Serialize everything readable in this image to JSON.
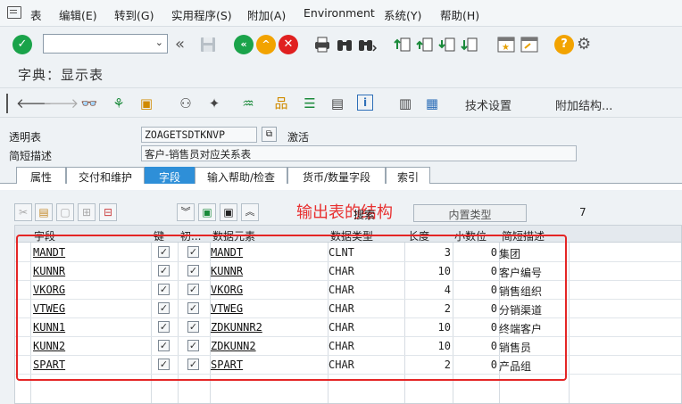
{
  "menu": [
    "表",
    "编辑(E)",
    "转到(G)",
    "实用程序(S)",
    "附加(A)",
    "Environment",
    "系统(Y)",
    "帮助(H)"
  ],
  "title": "字典：显示表",
  "app_toolbar": {
    "tech_settings": "技术设置",
    "append_structure": "附加结构..."
  },
  "fields": {
    "transparent_table_label": "透明表",
    "transparent_table_value": "ZOAGETSDTKNVP",
    "status": "激活",
    "short_desc_label": "简短描述",
    "short_desc_value": "客户-销售员对应关系表"
  },
  "tabs": [
    "属性",
    "交付和维护",
    "字段",
    "输入帮助/检查",
    "货币/数量字段",
    "索引"
  ],
  "annotation": "输出表的结构",
  "search_label": "搜索",
  "builtin_type": "内置类型",
  "count": "7",
  "columns": [
    "字段",
    "键",
    "初...",
    "数据元素",
    "数据类型",
    "长度",
    "小数位",
    "简短描述"
  ],
  "rows": [
    {
      "field": "MANDT",
      "element": "MANDT",
      "type": "CLNT",
      "length": "3",
      "decimals": "0",
      "desc": "集团"
    },
    {
      "field": "KUNNR",
      "element": "KUNNR",
      "type": "CHAR",
      "length": "10",
      "decimals": "0",
      "desc": "客户编号"
    },
    {
      "field": "VKORG",
      "element": "VKORG",
      "type": "CHAR",
      "length": "4",
      "decimals": "0",
      "desc": "销售组织"
    },
    {
      "field": "VTWEG",
      "element": "VTWEG",
      "type": "CHAR",
      "length": "2",
      "decimals": "0",
      "desc": "分销渠道"
    },
    {
      "field": "KUNN1",
      "element": "ZDKUNNR2",
      "type": "CHAR",
      "length": "10",
      "decimals": "0",
      "desc": "终端客户"
    },
    {
      "field": "KUNN2",
      "element": "ZDKUNN2",
      "type": "CHAR",
      "length": "10",
      "decimals": "0",
      "desc": "销售员"
    },
    {
      "field": "SPART",
      "element": "SPART",
      "type": "CHAR",
      "length": "2",
      "decimals": "0",
      "desc": "产品组"
    }
  ],
  "colors": {
    "accent": "#2e8fd8",
    "annotation": "#e83030",
    "ok_green": "#1aa34a",
    "exit_orange": "#f2a300",
    "cancel_red": "#e02020"
  },
  "icons": [
    "menu-icon",
    "enter-icon",
    "back-icon",
    "save-icon",
    "back-green-icon",
    "exit-icon",
    "cancel-icon",
    "print-icon",
    "find-icon",
    "find-next-icon",
    "first-page-icon",
    "prev-page-icon",
    "next-page-icon",
    "last-page-icon",
    "bookmark-icon",
    "create-session-icon",
    "help-icon",
    "customize-icon"
  ]
}
